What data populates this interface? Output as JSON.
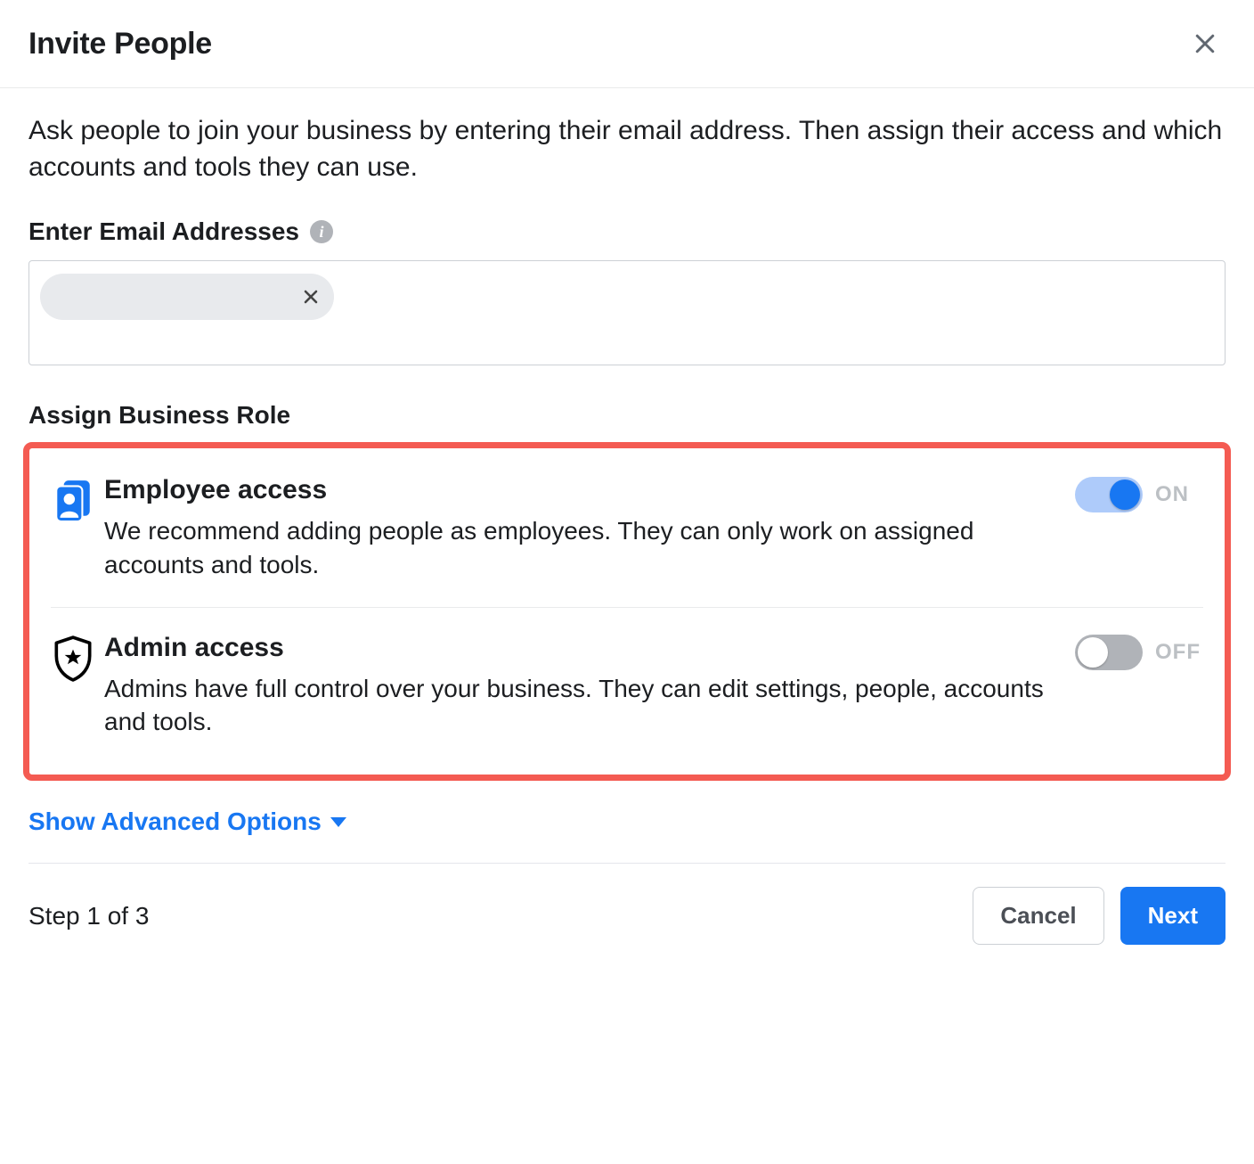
{
  "header": {
    "title": "Invite People"
  },
  "intro": "Ask people to join your business by entering their email address. Then assign their access and which accounts and tools they can use.",
  "email_section": {
    "label": "Enter Email Addresses",
    "chip_value": ""
  },
  "role_section": {
    "title": "Assign Business Role",
    "roles": [
      {
        "title": "Employee access",
        "description": "We recommend adding people as employees. They can only work on assigned accounts and tools.",
        "toggle_state": "ON",
        "toggle_on": true
      },
      {
        "title": "Admin access",
        "description": "Admins have full control over your business. They can edit settings, people, accounts and tools.",
        "toggle_state": "OFF",
        "toggle_on": false
      }
    ]
  },
  "advanced_link": "Show Advanced Options",
  "footer": {
    "step_text": "Step 1 of 3",
    "cancel": "Cancel",
    "next": "Next"
  }
}
